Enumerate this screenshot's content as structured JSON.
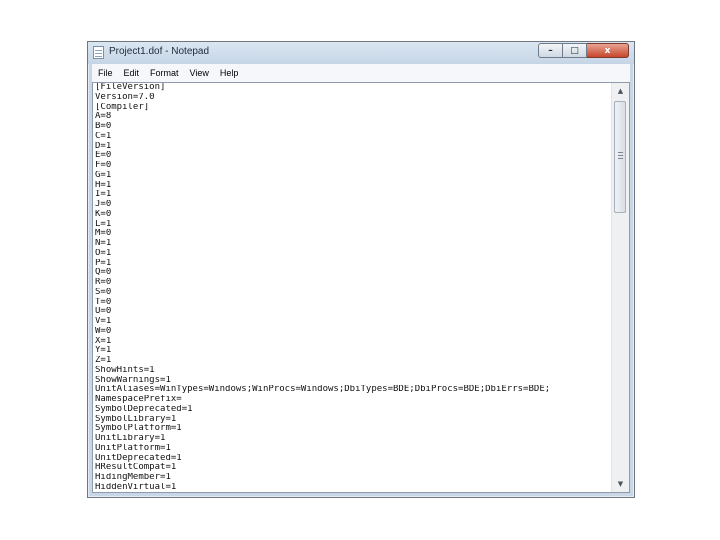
{
  "window": {
    "title": "Project1.dof - Notepad",
    "buttons": {
      "minimize": "–",
      "maximize": "□",
      "close": "x"
    }
  },
  "menu": [
    {
      "label": "File"
    },
    {
      "label": "Edit"
    },
    {
      "label": "Format"
    },
    {
      "label": "View"
    },
    {
      "label": "Help"
    }
  ],
  "editor": {
    "lines": [
      "[FileVersion]",
      "Version=7.0",
      "[Compiler]",
      "A=8",
      "B=0",
      "C=1",
      "D=1",
      "E=0",
      "F=0",
      "G=1",
      "H=1",
      "I=1",
      "J=0",
      "K=0",
      "L=1",
      "M=0",
      "N=1",
      "O=1",
      "P=1",
      "Q=0",
      "R=0",
      "S=0",
      "T=0",
      "U=0",
      "V=1",
      "W=0",
      "X=1",
      "Y=1",
      "Z=1",
      "ShowHints=1",
      "ShowWarnings=1",
      "UnitAliases=WinTypes=Windows;WinProcs=Windows;DbiTypes=BDE;DbiProcs=BDE;DbiErrs=BDE;",
      "NamespacePrefix=",
      "SymbolDeprecated=1",
      "SymbolLibrary=1",
      "SymbolPlatform=1",
      "UnitLibrary=1",
      "UnitPlatform=1",
      "UnitDeprecated=1",
      "HResultCompat=1",
      "HidingMember=1",
      "HiddenVirtual=1"
    ]
  },
  "scrollbar": {
    "up_arrow": "▲",
    "down_arrow": "▼"
  },
  "icons": [
    "notepad-icon",
    "scroll-up-icon",
    "scroll-down-icon"
  ]
}
